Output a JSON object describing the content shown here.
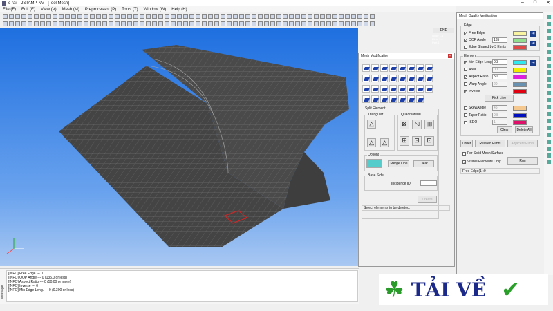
{
  "window": {
    "title": "c-rail - JSTAMP-NV - [Tool Mesh]",
    "controls": [
      "–",
      "□",
      "✕"
    ]
  },
  "menu": [
    "File (F)",
    "Edit (E)",
    "View (V)",
    "Mesh (M)",
    "Preprocessor (P)",
    "Tools (T)",
    "Window (W)",
    "Help (H)"
  ],
  "viewport": {
    "end_label": "END",
    "stats": [
      "Node 1.1",
      "Elem 1.1",
      "Part 1"
    ]
  },
  "mesh_mod": {
    "title": "Mesh Modification",
    "split_element": "Split Element",
    "triangular": "Triangular",
    "quadrilateral": "Quadrilateral",
    "options": "Options",
    "merge_line": "Merge Line",
    "clear": "Clear",
    "base_side": "Base Side",
    "incidence_id": "Incidence ID",
    "incidence_value": "",
    "create": "Create",
    "status": "Select elements to be deleted."
  },
  "quality": {
    "title": "Mesh Quality Verification",
    "edge_group": "Edge",
    "edge_items": [
      {
        "label": "Free Edge",
        "checked": true,
        "value": "",
        "color": "#f7f3a0"
      },
      {
        "label": "OOP Angle",
        "checked": true,
        "value": "135",
        "color": "#90e090"
      },
      {
        "label": "Edge Shared by 3 Elmts",
        "checked": false,
        "value": "",
        "color": "#e04848"
      }
    ],
    "element_group": "Element",
    "element_items": [
      {
        "label": "Min Edge Leng.",
        "checked": true,
        "value": "0.3",
        "color": "#30e8f0"
      },
      {
        "label": "Area",
        "checked": false,
        "value": "0.1",
        "color": "#f0f000"
      },
      {
        "label": "Aspect Ratio",
        "checked": true,
        "value": "50",
        "color": "#e020e0"
      },
      {
        "label": "Warp Angle",
        "checked": false,
        "value": "20",
        "color": "#6890b0"
      },
      {
        "label": "Inverse",
        "checked": true,
        "value": "",
        "color": "#e00010"
      }
    ],
    "pick_line": "Pick Line",
    "element_items2": [
      {
        "label": "SkewAngle",
        "checked": false,
        "value": "45",
        "color": "#f5c890"
      },
      {
        "label": "Taper Ratio",
        "checked": false,
        "value": "0.8",
        "color": "#0010c0"
      },
      {
        "label": "ISDO",
        "checked": false,
        "value": "1",
        "color": "#e0106a"
      }
    ],
    "clear": "Clear",
    "delete_all": "Delete All",
    "order": "Order",
    "related_elmts": "Related Elmts",
    "adjacent_elmts": "Adjacent Elmts",
    "solid_surface": "For Solid Mesh Surface",
    "visible_only": "Visible Elements Only",
    "run": "Run",
    "result": "Free Edge(1):0"
  },
  "messages": {
    "side_label": "Message",
    "lines": [
      "[INFO] Free Edge --- 0",
      "[INFO] OOP Angle --- 0 (135.0 or less)",
      "[INFO] Aspect Ratio --- 0 (50.00 or more)",
      "[INFO] Inverse --- 0",
      "[INFO] Min Edge Leng. --- 0 (0.300 or less)"
    ]
  },
  "watermark": {
    "text": "TẢI VỀ"
  }
}
